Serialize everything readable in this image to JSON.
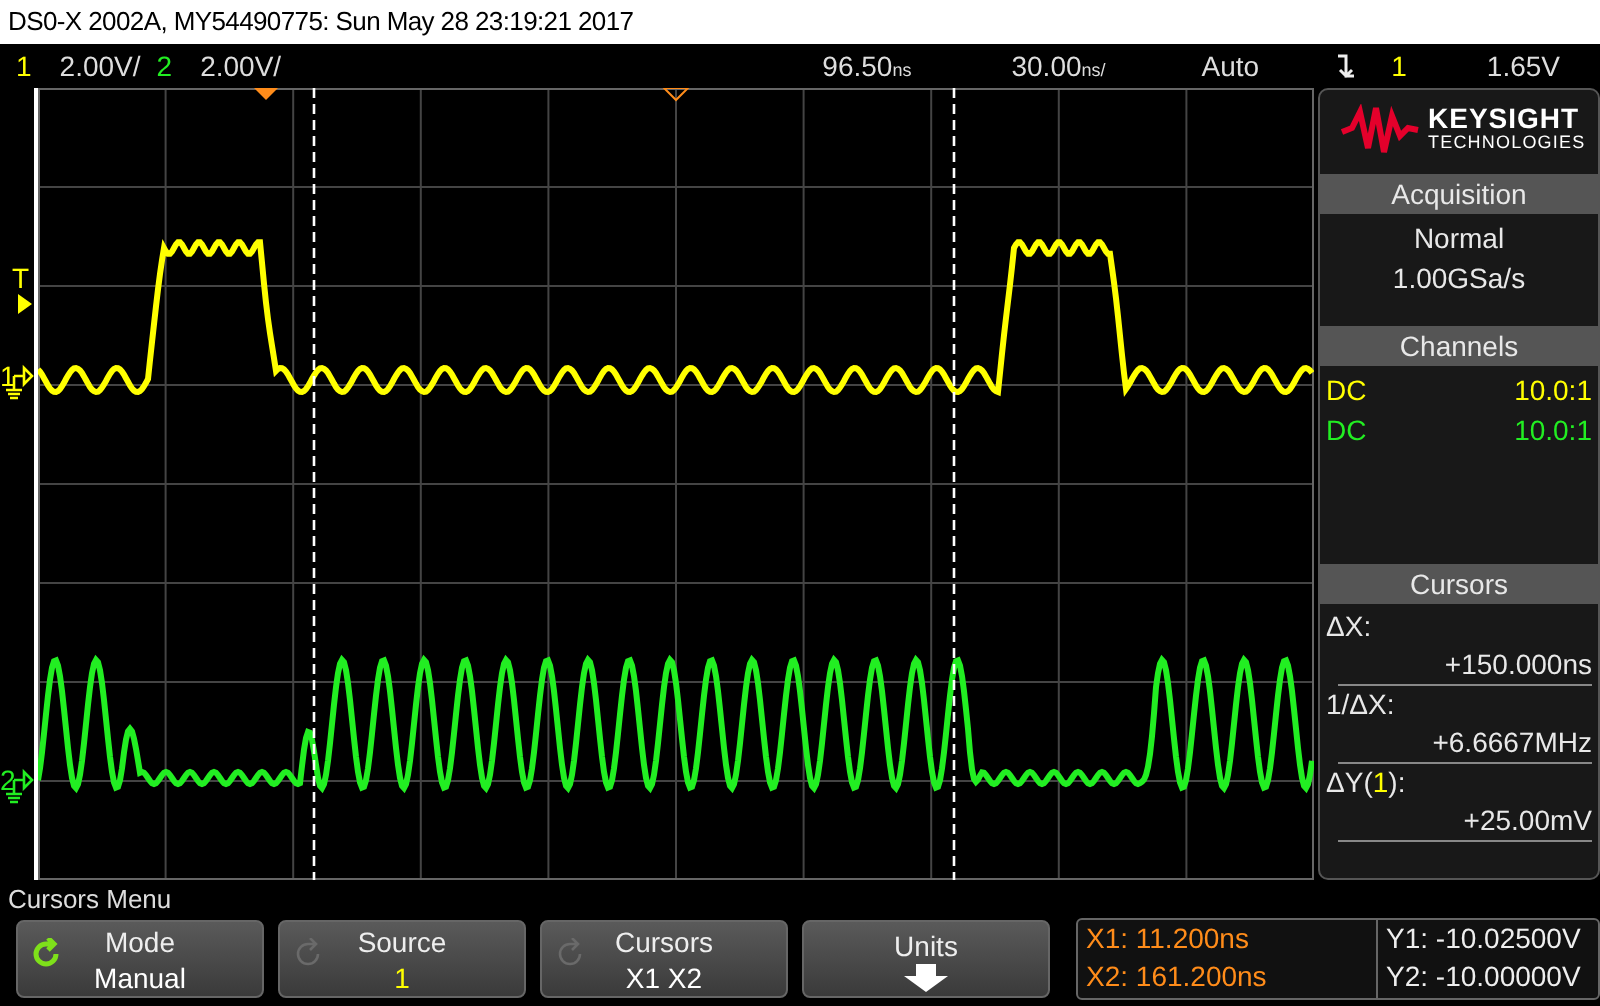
{
  "window": {
    "title": "DS0-X 2002A, MY54490775: Sun May 28 23:19:21 2017"
  },
  "status_bar": {
    "channels": [
      {
        "number": "1",
        "scale": "2.00V/",
        "color": "#ffff00"
      },
      {
        "number": "2",
        "scale": "2.00V/",
        "color": "#22ee22"
      }
    ],
    "delay": "96.50",
    "delay_unit": "ns",
    "timebase": "30.00",
    "timebase_unit": "ns/",
    "trigger_mode": "Auto",
    "trigger_source": "1",
    "trigger_level": "1.65V"
  },
  "display": {
    "trigger_label": "T",
    "channel_markers": [
      {
        "number": "1",
        "color": "#ffff00"
      },
      {
        "number": "2",
        "color": "#22ee22"
      }
    ]
  },
  "side_panel": {
    "logo": {
      "name": "KEYSIGHT",
      "subtitle": "TECHNOLOGIES"
    },
    "acquisition": {
      "title": "Acquisition",
      "mode": "Normal",
      "rate": "1.00GSa/s"
    },
    "channels": {
      "title": "Channels",
      "rows": [
        {
          "coupling": "DC",
          "probe": "10.0:1",
          "color": "#ffff00"
        },
        {
          "coupling": "DC",
          "probe": "10.0:1",
          "color": "#22ee22"
        }
      ]
    },
    "cursors": {
      "title": "Cursors",
      "readouts": [
        {
          "label": "ΔX:",
          "value": "+150.000ns"
        },
        {
          "label": "1/ΔX:",
          "value": "+6.6667MHz"
        },
        {
          "label": "ΔY(",
          "source": "1",
          "label_end": "):",
          "value": "+25.00mV"
        }
      ]
    }
  },
  "menu": {
    "title": "Cursors Menu",
    "softkeys": [
      {
        "kind": "cycle",
        "label": "Mode",
        "value": "Manual",
        "active": true,
        "color": "#ffffff"
      },
      {
        "kind": "cycle",
        "label": "Source",
        "value": "1",
        "active": false,
        "color": "#ffff00"
      },
      {
        "kind": "cycle",
        "label": "Cursors",
        "value": "X1 X2",
        "active": false,
        "color": "#ffffff"
      },
      {
        "kind": "submenu",
        "label": "Units"
      }
    ],
    "x_readouts": [
      "X1: 11.200ns",
      "X2: 161.200ns"
    ],
    "y_readouts": [
      "Y1: -10.02500V",
      "Y2: -10.00000V"
    ]
  }
}
